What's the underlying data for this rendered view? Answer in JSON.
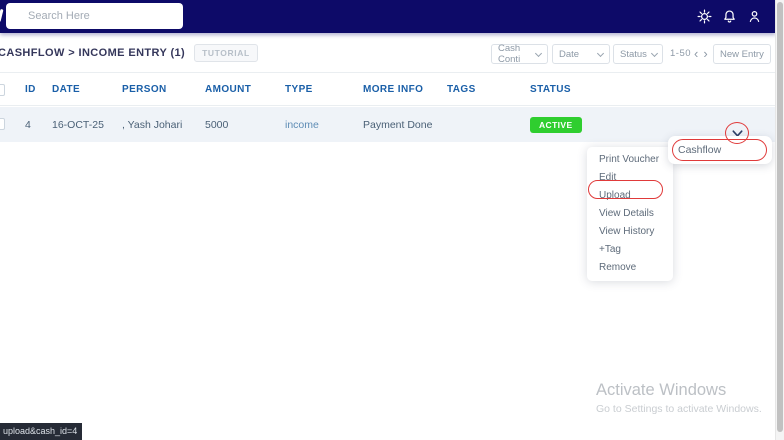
{
  "navbar": {
    "search": {
      "placeholder": "Search Here"
    },
    "icons": [
      {
        "name": "gear-icon"
      },
      {
        "name": "bell-icon"
      },
      {
        "name": "person-icon"
      }
    ]
  },
  "toolbar": {
    "breadcrumb": "CASHFLOW > INCOME ENTRY (1)",
    "tutorial_badge": "TUTORIAL",
    "filters": {
      "cash_control": "Cash Conti",
      "date": "Date",
      "status": "Status"
    },
    "pagination": {
      "range": "1-50",
      "prev": "‹",
      "next": "›"
    },
    "new_entry": "New Entry"
  },
  "table": {
    "columns": [
      "ID",
      "DATE",
      "PERSON",
      "AMOUNT",
      "TYPE",
      "MORE INFO",
      "TAGS",
      "STATUS"
    ],
    "rows": [
      {
        "id": "4",
        "date": "16-OCT-25",
        "person": ", Yash Johari",
        "amount": "5000",
        "type": "income",
        "more_info": "Payment Done",
        "tags": "",
        "status": "ACTIVE"
      }
    ]
  },
  "context_menu": {
    "items": [
      "Print Voucher",
      "Edit",
      "Upload",
      "View Details",
      "View History",
      "+Tag",
      "Remove"
    ]
  },
  "flyout": {
    "label": "Cashflow"
  },
  "watermark": {
    "title": "Activate Windows",
    "subtitle": "Go to Settings to activate Windows."
  },
  "status_bar": {
    "url_fragment": "upload&cash_id=4"
  },
  "colors": {
    "navbar_navy": "#0d0a68",
    "header_blue": "#1a5fa8",
    "row_bg": "#eff3f8",
    "active_green": "#2fce2f",
    "annotation_red": "#e03a3a"
  }
}
